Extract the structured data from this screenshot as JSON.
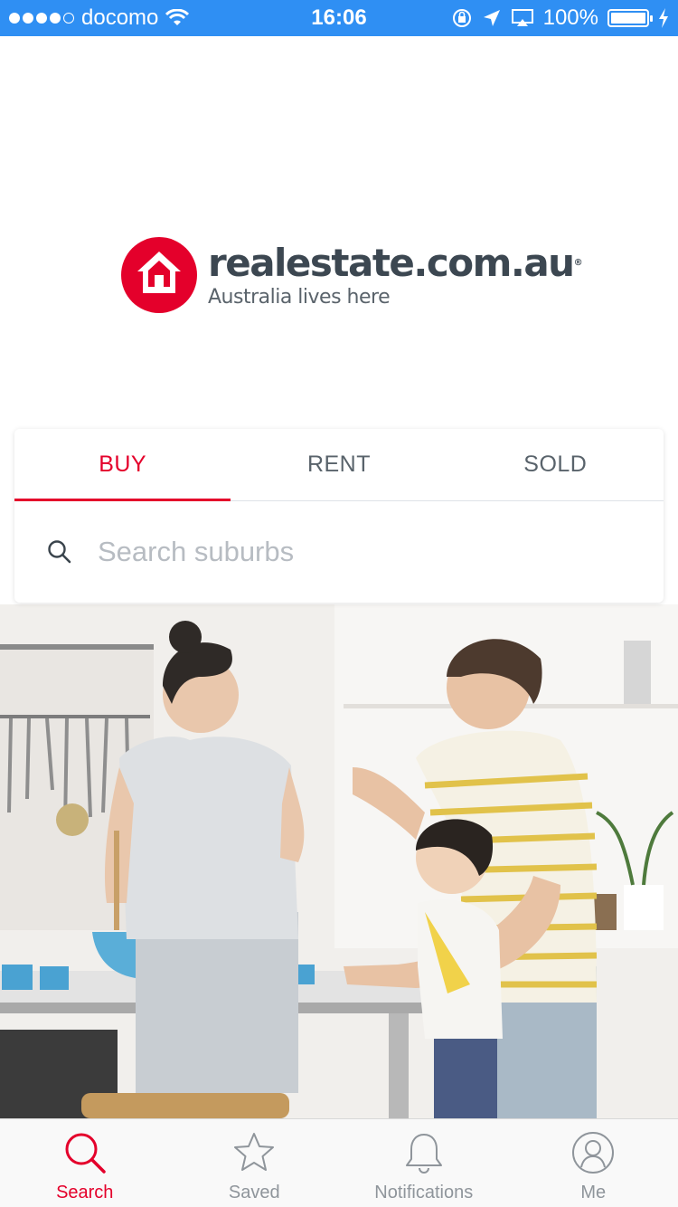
{
  "status_bar": {
    "carrier": "docomo",
    "time": "16:06",
    "battery": "100%",
    "icons": [
      "signal-dots",
      "wifi-icon",
      "rotation-lock-icon",
      "location-arrow-icon",
      "airplay-icon",
      "battery-icon",
      "charging-bolt-icon"
    ]
  },
  "logo": {
    "name": "realestate.com.au",
    "registered": "®",
    "tagline": "Australia lives here",
    "brand_color": "#e4002b"
  },
  "search_card": {
    "tabs": [
      {
        "label": "BUY",
        "active": true
      },
      {
        "label": "RENT",
        "active": false
      },
      {
        "label": "SOLD",
        "active": false
      }
    ],
    "search": {
      "placeholder": "Search suburbs",
      "value": ""
    }
  },
  "hero": {
    "image_subject": "family-in-kitchen-photo"
  },
  "tab_bar": {
    "items": [
      {
        "label": "Search",
        "icon": "search-icon",
        "active": true
      },
      {
        "label": "Saved",
        "icon": "star-icon",
        "active": false
      },
      {
        "label": "Notifications",
        "icon": "bell-icon",
        "active": false
      },
      {
        "label": "Me",
        "icon": "user-icon",
        "active": false
      }
    ]
  },
  "colors": {
    "status_bar": "#2f8ff3",
    "accent": "#e4002b",
    "text": "#333f48",
    "muted": "#8f959b"
  }
}
